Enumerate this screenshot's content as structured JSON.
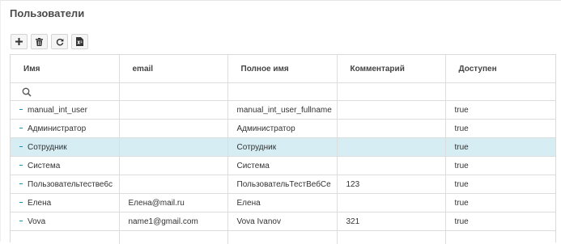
{
  "page": {
    "title": "Пользователи"
  },
  "toolbar": {
    "buttons": [
      {
        "icon": "plus-icon"
      },
      {
        "icon": "trash-icon"
      },
      {
        "icon": "refresh-icon"
      },
      {
        "icon": "excel-export-icon"
      }
    ]
  },
  "grid": {
    "columns": [
      "Имя",
      "email",
      "Полное имя",
      "Комментарий",
      "Доступен"
    ],
    "filter": {
      "icon": "search-icon"
    },
    "rows": [
      {
        "name": "manual_int_user",
        "email": "",
        "full_name": "manual_int_user_fullname",
        "comment": "",
        "enabled": "true",
        "selected": false
      },
      {
        "name": "Администратор",
        "email": "",
        "full_name": "Администратор",
        "comment": "",
        "enabled": "true",
        "selected": false
      },
      {
        "name": "Сотрудник",
        "email": "",
        "full_name": "Сотрудник",
        "comment": "",
        "enabled": "true",
        "selected": true
      },
      {
        "name": "Система",
        "email": "",
        "full_name": "Система",
        "comment": "",
        "enabled": "true",
        "selected": false
      },
      {
        "name": "Пользовательтестве6с",
        "email": "",
        "full_name": "ПользовательТестВебСе",
        "comment": "123",
        "enabled": "true",
        "selected": false
      },
      {
        "name": "Елена",
        "email": "Елена@mail.ru",
        "full_name": "Елена",
        "comment": "",
        "enabled": "true",
        "selected": false
      },
      {
        "name": "Vova",
        "email": "name1@gmail.com",
        "full_name": "Vova Ivanov",
        "comment": "321",
        "enabled": "true",
        "selected": false
      }
    ]
  },
  "colors": {
    "selected_row": "#d5edf3",
    "tree_marker": "#1a8fb5",
    "border": "#dddddd"
  }
}
